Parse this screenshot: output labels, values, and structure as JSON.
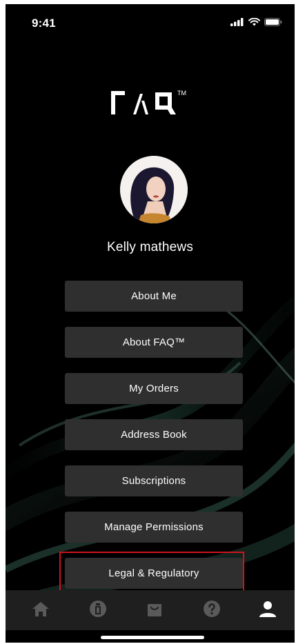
{
  "status_bar": {
    "time": "9:41"
  },
  "logo": {
    "text": "FAQ",
    "trademark": "TM"
  },
  "profile": {
    "name": "Kelly mathews"
  },
  "menu": {
    "items": [
      {
        "label": "About Me"
      },
      {
        "label": "About FAQ™"
      },
      {
        "label": "My Orders"
      },
      {
        "label": "Address Book"
      },
      {
        "label": "Subscriptions"
      },
      {
        "label": "Manage Permissions"
      },
      {
        "label": "Legal & Regulatory"
      }
    ]
  },
  "tabbar": {
    "tabs": [
      {
        "icon": "home-icon",
        "active": false
      },
      {
        "icon": "bottle-icon",
        "active": false
      },
      {
        "icon": "shopping-bag-icon",
        "active": false
      },
      {
        "icon": "help-icon",
        "active": false
      },
      {
        "icon": "user-icon",
        "active": true
      }
    ]
  },
  "colors": {
    "background": "#000000",
    "button": "#2f2f2f",
    "tabbar": "#1f1f1f",
    "inactive_icon": "#5a5a5a",
    "active_icon": "#ffffff",
    "highlight": "#d1131f"
  }
}
